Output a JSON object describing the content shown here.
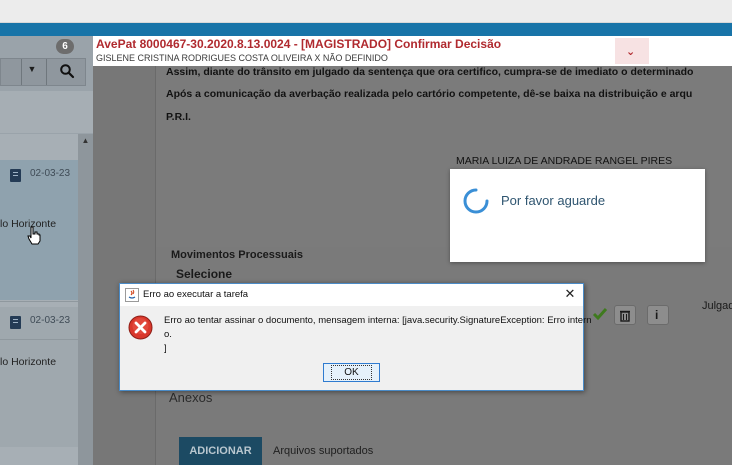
{
  "colors": {
    "accent_blue": "#1874a8",
    "title_red": "#b02a2f",
    "overlay_gray": "#777777",
    "wait_text": "#2f5570",
    "add_button": "#1c4a63"
  },
  "left_panel": {
    "badge_count": "6",
    "toolbar": {
      "dropdown_icon": "caret-down-icon",
      "search_icon": "search-icon"
    },
    "items": [
      {
        "date": "02-03-23",
        "location": "lo Horizonte",
        "icon": "document-icon"
      },
      {
        "date": "02-03-23",
        "location": "lo Horizonte",
        "icon": "document-icon"
      }
    ]
  },
  "header": {
    "title": "AvePat 8000467-30.2020.8.13.0024 - [MAGISTRADO] Confirmar Decisão",
    "subtitle": "GISLENE CRISTINA RODRIGUES COSTA OLIVEIRA X NÃO DEFINIDO",
    "toggle_icon": "chevron-down-icon"
  },
  "document": {
    "lines": [
      "Assim, diante do trânsito em julgado da sentença que ora certifico, cumpra-se de imediato o determinado",
      "Após a comunicação da averbação realizada pelo cartório competente, dê-se baixa na distribuição e arqu",
      "P.R.I."
    ],
    "signature": "MARIA LUIZA DE ANDRADE RANGEL PIRES"
  },
  "movements": {
    "title": "Movimentos Processuais",
    "select_label": "Selecione",
    "row_text": "Julgado"
  },
  "attachments": {
    "title": "Anexos",
    "add_button": "ADICIONAR",
    "supported_files": "Arquivos suportados"
  },
  "wait_dialog": {
    "message": "Por favor aguarde"
  },
  "error_dialog": {
    "title": "Erro ao executar a tarefa",
    "message_lines": [
      "Erro ao tentar assinar o documento, mensagem interna: [java.security.SignatureException: Erro intern",
      "o.",
      "]"
    ],
    "ok_label": "OK"
  }
}
